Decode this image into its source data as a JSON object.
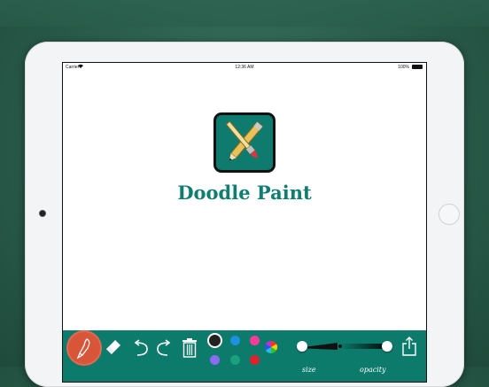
{
  "status_bar": {
    "carrier": "Carrier",
    "time": "12:36 AM",
    "battery": "100%"
  },
  "app": {
    "title": "Doodle Paint"
  },
  "toolbar": {
    "tools": [
      "brush-icon",
      "eraser-icon",
      "undo-icon",
      "redo-icon",
      "trash-icon"
    ],
    "colors": [
      "#222222",
      "#1f8fe0",
      "#ff3b9a",
      "#8b6cf0",
      "#1aa07a",
      "#e0202a"
    ],
    "selected_color": "#222222",
    "size_label": "size",
    "opacity_label": "opacity",
    "size_value": 0.05,
    "opacity_value": 0.95
  }
}
